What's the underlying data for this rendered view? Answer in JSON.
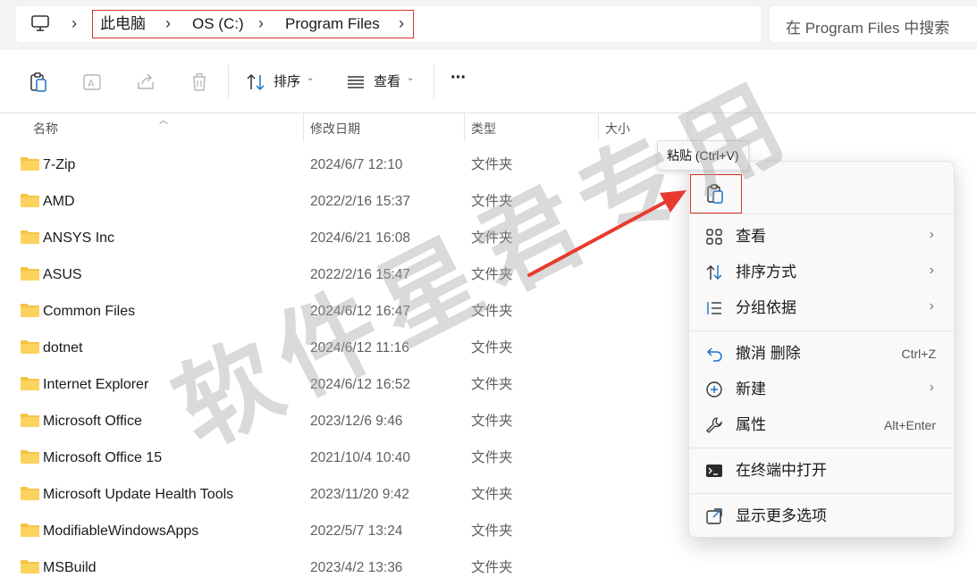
{
  "address_bar": {
    "crumbs": [
      "此电脑",
      "OS (C:)",
      "Program Files"
    ],
    "search_placeholder": "在 Program Files 中搜索"
  },
  "toolbar": {
    "sort_label": "排序",
    "view_label": "查看",
    "more_label": "···"
  },
  "columns": {
    "name": "名称",
    "modified": "修改日期",
    "type": "类型",
    "size": "大小"
  },
  "files": [
    {
      "name": "7-Zip",
      "modified": "2024/6/7 12:10",
      "type": "文件夹"
    },
    {
      "name": "AMD",
      "modified": "2022/2/16 15:37",
      "type": "文件夹"
    },
    {
      "name": "ANSYS Inc",
      "modified": "2024/6/21 16:08",
      "type": "文件夹"
    },
    {
      "name": "ASUS",
      "modified": "2022/2/16 15:47",
      "type": "文件夹"
    },
    {
      "name": "Common Files",
      "modified": "2024/6/12 16:47",
      "type": "文件夹"
    },
    {
      "name": "dotnet",
      "modified": "2024/6/12 11:16",
      "type": "文件夹"
    },
    {
      "name": "Internet Explorer",
      "modified": "2024/6/12 16:52",
      "type": "文件夹"
    },
    {
      "name": "Microsoft Office",
      "modified": "2023/12/6 9:46",
      "type": "文件夹"
    },
    {
      "name": "Microsoft Office 15",
      "modified": "2021/10/4 10:40",
      "type": "文件夹"
    },
    {
      "name": "Microsoft Update Health Tools",
      "modified": "2023/11/20 9:42",
      "type": "文件夹"
    },
    {
      "name": "ModifiableWindowsApps",
      "modified": "2022/5/7 13:24",
      "type": "文件夹"
    },
    {
      "name": "MSBuild",
      "modified": "2023/4/2 13:36",
      "type": "文件夹"
    }
  ],
  "tooltip": "粘贴 (Ctrl+V)",
  "context_menu": {
    "items": [
      {
        "label": "查看",
        "icon": "grid-view-icon",
        "arrow": true
      },
      {
        "label": "排序方式",
        "icon": "sort-icon",
        "arrow": true
      },
      {
        "label": "分组依据",
        "icon": "group-list-icon",
        "arrow": true
      },
      {
        "label": "撤消 删除",
        "icon": "undo-icon",
        "shortcut": "Ctrl+Z"
      },
      {
        "label": "新建",
        "icon": "new-plus-icon",
        "arrow": true
      },
      {
        "label": "属性",
        "icon": "wrench-icon",
        "shortcut": "Alt+Enter"
      },
      {
        "label": "在终端中打开",
        "icon": "terminal-icon"
      },
      {
        "label": "显示更多选项",
        "icon": "more-options-icon"
      }
    ]
  },
  "watermark": "软件星君专用",
  "colors": {
    "highlight_border": "#d9332b",
    "folder": "#f6c343",
    "arrow": "#e83a2e"
  }
}
